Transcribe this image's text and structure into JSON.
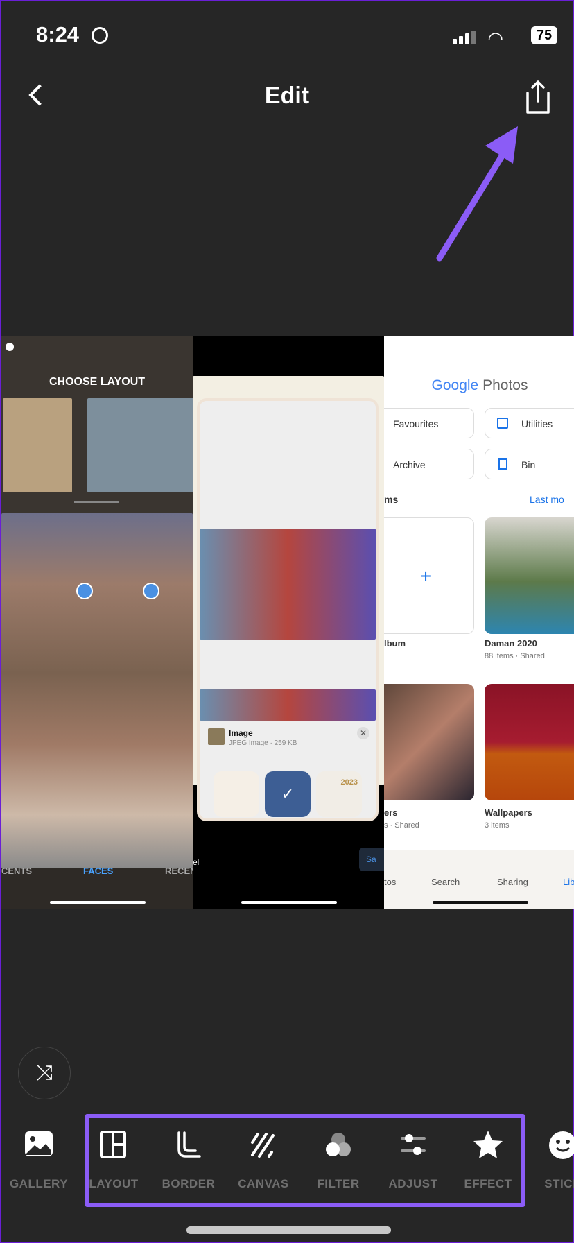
{
  "status": {
    "time": "8:24",
    "battery": "75"
  },
  "nav": {
    "title": "Edit",
    "back_icon": "chevron-left-icon",
    "share_icon": "share-icon"
  },
  "annotation": {
    "arrow_color": "#8b5cf6",
    "box_color": "#8b5cf6"
  },
  "panel_left": {
    "title": "CHOOSE LAYOUT",
    "tabs": [
      "CENTS",
      "FACES",
      "RECEN"
    ]
  },
  "panel_middle": {
    "file_name": "Image",
    "file_meta": "JPEG Image · 259 KB",
    "badge_year": "2023",
    "cancel": "el",
    "save": "Sa"
  },
  "panel_right": {
    "logo_google": "Google",
    "logo_photos": "Photos",
    "cards": [
      "Favourites",
      "Utilities",
      "Archive",
      "Bin"
    ],
    "section": "ms",
    "sort": "Last mo",
    "albums": [
      {
        "title": "lbum",
        "meta": ""
      },
      {
        "title": "Daman 2020",
        "meta": "88 items · Shared"
      },
      {
        "title": "ers",
        "meta": "s · Shared"
      },
      {
        "title": "Wallpapers",
        "meta": "3 items"
      }
    ],
    "tabs": [
      "tos",
      "Search",
      "Sharing",
      "Lib"
    ]
  },
  "toolbar": {
    "items": [
      {
        "label": "GALLERY",
        "icon": "image-icon"
      },
      {
        "label": "LAYOUT",
        "icon": "layout-icon"
      },
      {
        "label": "BORDER",
        "icon": "border-icon"
      },
      {
        "label": "CANVAS",
        "icon": "canvas-icon"
      },
      {
        "label": "FILTER",
        "icon": "filter-icon"
      },
      {
        "label": "ADJUST",
        "icon": "sliders-icon"
      },
      {
        "label": "EFFECT",
        "icon": "star-icon"
      },
      {
        "label": "STICK",
        "icon": "smiley-icon"
      }
    ],
    "shuffle_icon": "shuffle-icon"
  }
}
